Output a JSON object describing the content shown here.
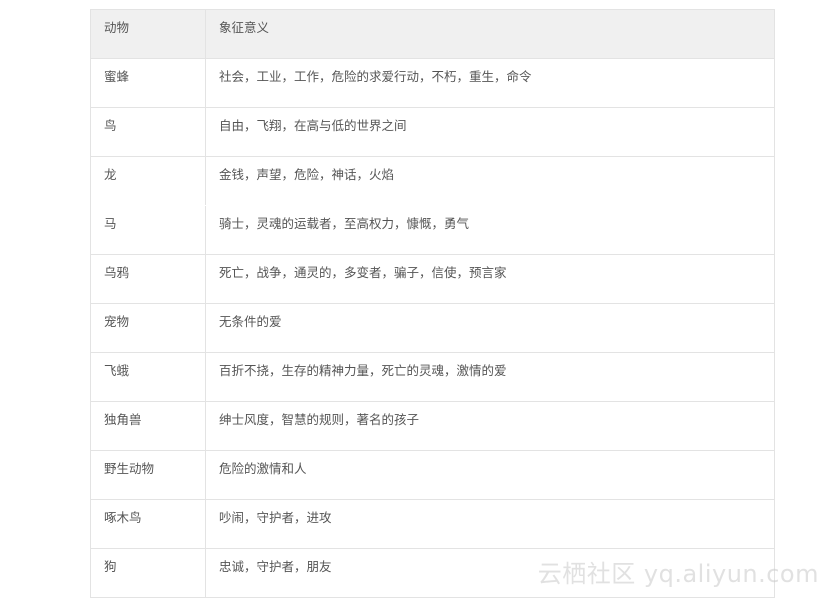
{
  "table": {
    "header": {
      "animal": "动物",
      "meaning": "象征意义"
    },
    "rows": [
      {
        "animal": "蜜蜂",
        "meaning": "社会，工业，工作，危险的求爱行动，不朽，重生，命令"
      },
      {
        "animal": "鸟",
        "meaning": "自由，飞翔，在高与低的世界之间"
      },
      {
        "animal": "龙",
        "meaning": "金钱，声望，危险，神话，火焰"
      },
      {
        "animal": "马",
        "meaning": "骑士，灵魂的运载者，至高权力，慷慨，勇气"
      },
      {
        "animal": "乌鸦",
        "meaning": "死亡，战争，通灵的，多变者，骗子，信使，预言家"
      },
      {
        "animal": "宠物",
        "meaning": "无条件的爱"
      },
      {
        "animal": "飞蛾",
        "meaning": "百折不挠，生存的精神力量，死亡的灵魂，激情的爱"
      },
      {
        "animal": "独角兽",
        "meaning": "绅士风度，智慧的规则，著名的孩子"
      },
      {
        "animal": "野生动物",
        "meaning": "危险的激情和人"
      },
      {
        "animal": "啄木鸟",
        "meaning": "吵闹，守护者，进攻"
      },
      {
        "animal": "狗",
        "meaning": "忠诚，守护者，朋友"
      }
    ]
  },
  "watermark": "云栖社区 yq.aliyun.com"
}
